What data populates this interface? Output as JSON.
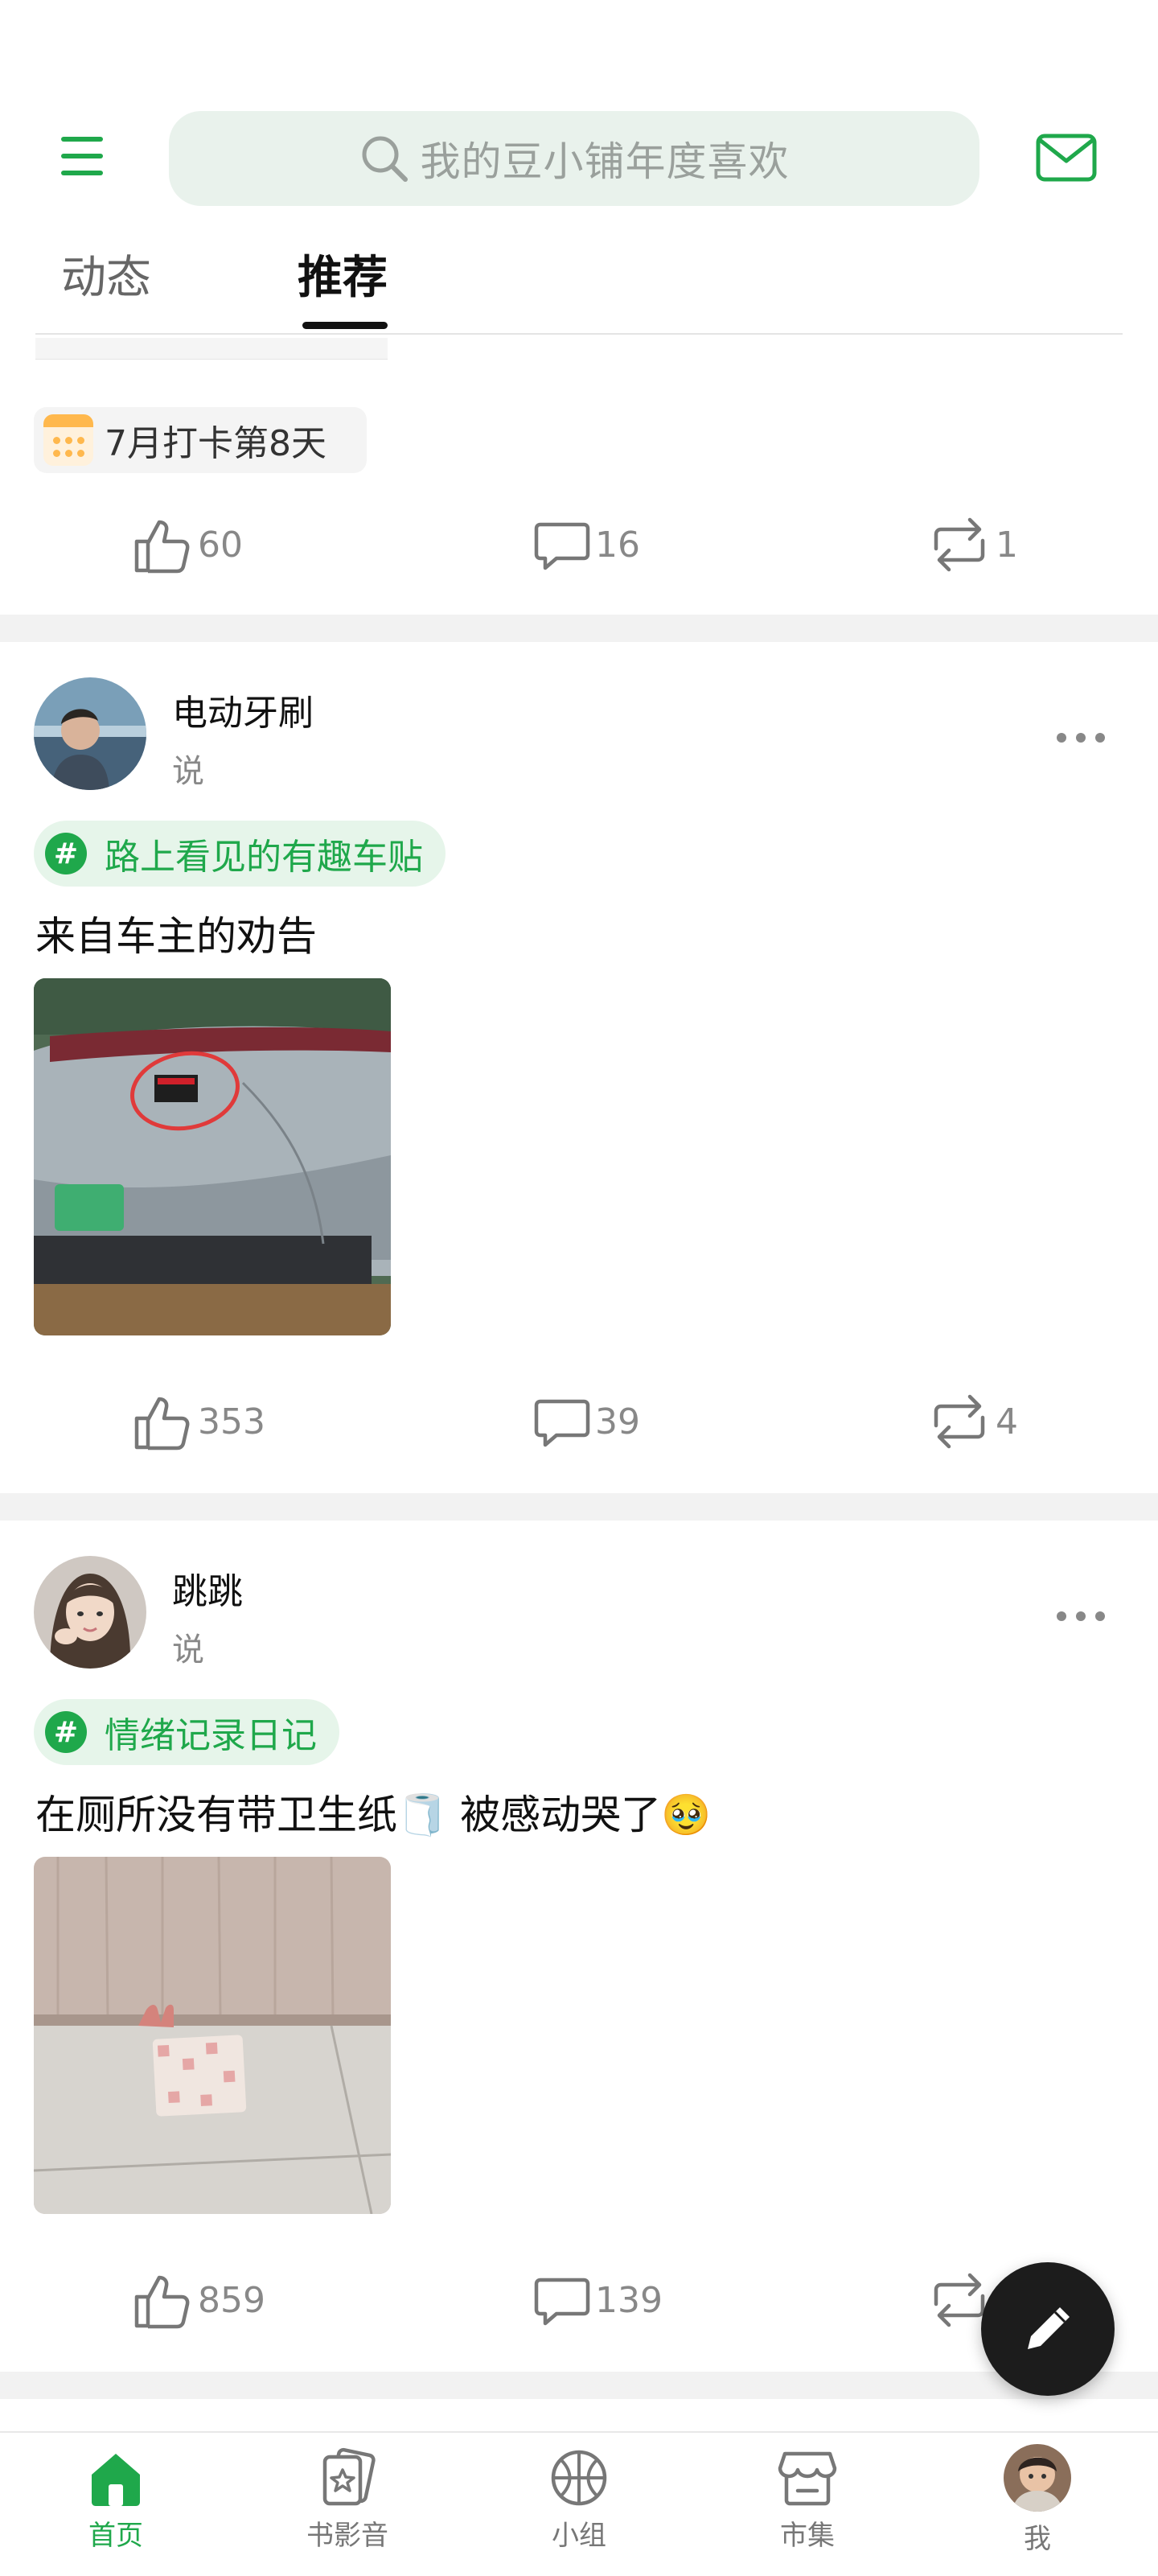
{
  "header": {
    "search_placeholder": "我的豆小铺年度喜欢",
    "tabs": [
      {
        "label": "动态"
      },
      {
        "label": "推荐"
      }
    ]
  },
  "prev_post": {
    "checkin_label": "7月打卡第8天",
    "likes": "60",
    "comments": "16",
    "reposts": "1"
  },
  "posts": [
    {
      "author": "电动牙刷",
      "verb": "说",
      "topic": "路上看见的有趣车贴",
      "text": "来自车主的劝告",
      "likes": "353",
      "comments": "39",
      "reposts": "4"
    },
    {
      "author": "跳跳",
      "verb": "说",
      "topic": "情绪记录日记",
      "text": "在厕所没有带卫生纸🧻 被感动哭了🥹",
      "likes": "859",
      "comments": "139"
    }
  ],
  "bottom_nav": [
    {
      "label": "首页",
      "icon": "home-icon",
      "active": true
    },
    {
      "label": "书影音",
      "icon": "film-star-icon"
    },
    {
      "label": "小组",
      "icon": "group-ball-icon"
    },
    {
      "label": "市集",
      "icon": "market-icon"
    },
    {
      "label": "我",
      "icon": "avatar"
    }
  ],
  "colors": {
    "accent": "#1fa84b",
    "search_bg": "#e9f2ec",
    "chip_bg": "#e6f5ea",
    "fab": "#1c1c1c"
  }
}
